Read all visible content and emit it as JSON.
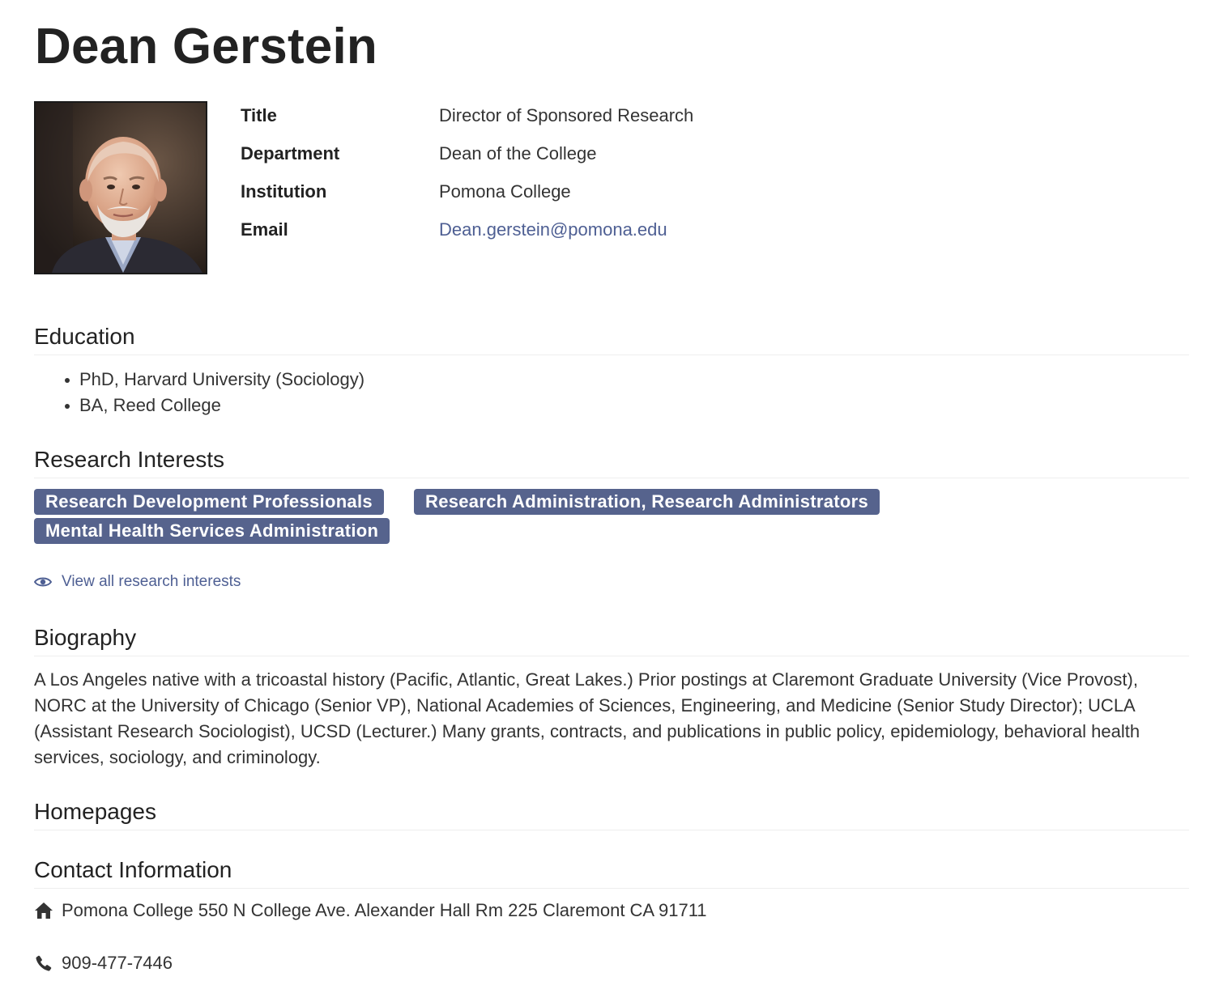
{
  "profile": {
    "name": "Dean Gerstein",
    "fields": [
      {
        "label": "Title",
        "value": "Director of Sponsored Research"
      },
      {
        "label": "Department",
        "value": "Dean of the College"
      },
      {
        "label": "Institution",
        "value": "Pomona College"
      },
      {
        "label": "Email",
        "value": "Dean.gerstein@pomona.edu"
      }
    ]
  },
  "education": {
    "heading": "Education",
    "items": [
      "PhD, Harvard University (Sociology)",
      "BA, Reed College"
    ]
  },
  "research": {
    "heading": "Research Interests",
    "tags": [
      "Research Development Professionals",
      "Research Administration, Research Administrators",
      "Mental Health Services Administration"
    ],
    "view_all_label": "View all research interests"
  },
  "biography": {
    "heading": "Biography",
    "text": "A Los Angeles native with a tricoastal history (Pacific, Atlantic, Great Lakes.) Prior postings at Claremont Graduate University (Vice Provost), NORC at the University of Chicago (Senior VP), National Academies of Sciences, Engineering, and Medicine (Senior Study Director); UCLA (Assistant Research Sociologist), UCSD (Lecturer.) Many grants, contracts, and publications in public policy, epidemiology, behavioral health services, sociology, and criminology."
  },
  "homepages": {
    "heading": "Homepages"
  },
  "contact": {
    "heading": "Contact Information",
    "address": "Pomona College 550 N College Ave. Alexander Hall Rm 225 Claremont CA 91711",
    "phone": "909-477-7446"
  },
  "icons": {
    "view_all": "eye-icon",
    "address": "home-icon",
    "phone": "phone-icon"
  },
  "colors": {
    "tag_background": "#56638d",
    "link": "#4e5f93",
    "heading_text": "#222222"
  }
}
